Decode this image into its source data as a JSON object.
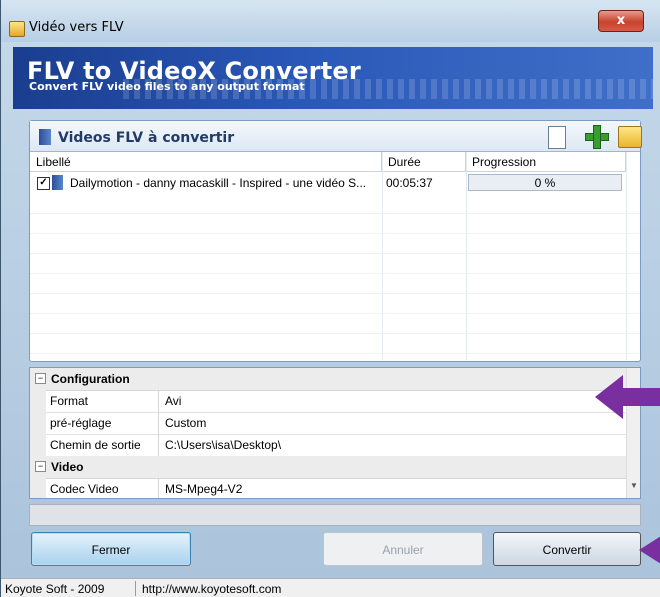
{
  "window": {
    "title": "Vidéo vers FLV",
    "close_glyph": "x"
  },
  "banner": {
    "title": "FLV to VideoX Converter",
    "subtitle": "Convert FLV video files to any output format"
  },
  "videos_panel": {
    "title": "Videos FLV à convertir",
    "toolbar_icons": [
      "new-document-icon",
      "add-icon",
      "open-folder-icon"
    ],
    "columns": [
      "Libellé",
      "Durée",
      "Progression"
    ],
    "rows": [
      {
        "checked": true,
        "label": "Dailymotion - danny macaskill - Inspired - une vidéo S...",
        "duration": "00:05:37",
        "progress": "0 %"
      }
    ]
  },
  "properties": {
    "categories": [
      {
        "name": "Configuration",
        "items": [
          {
            "key": "Format",
            "value": "Avi"
          },
          {
            "key": "pré-réglage",
            "value": "Custom"
          },
          {
            "key": "Chemin de sortie",
            "value": "C:\\Users\\isa\\Desktop\\"
          }
        ]
      },
      {
        "name": "Video",
        "items": [
          {
            "key": "Codec Video",
            "value": "MS-Mpeg4-V2"
          }
        ]
      }
    ]
  },
  "buttons": {
    "close": "Fermer",
    "cancel": "Annuler",
    "convert": "Convertir"
  },
  "statusbar": {
    "company": "Koyote Soft - 2009",
    "url": "http://www.koyotesoft.com"
  },
  "colors": {
    "annotation_arrow": "#7a2fa0",
    "banner": "#2a58b8"
  }
}
